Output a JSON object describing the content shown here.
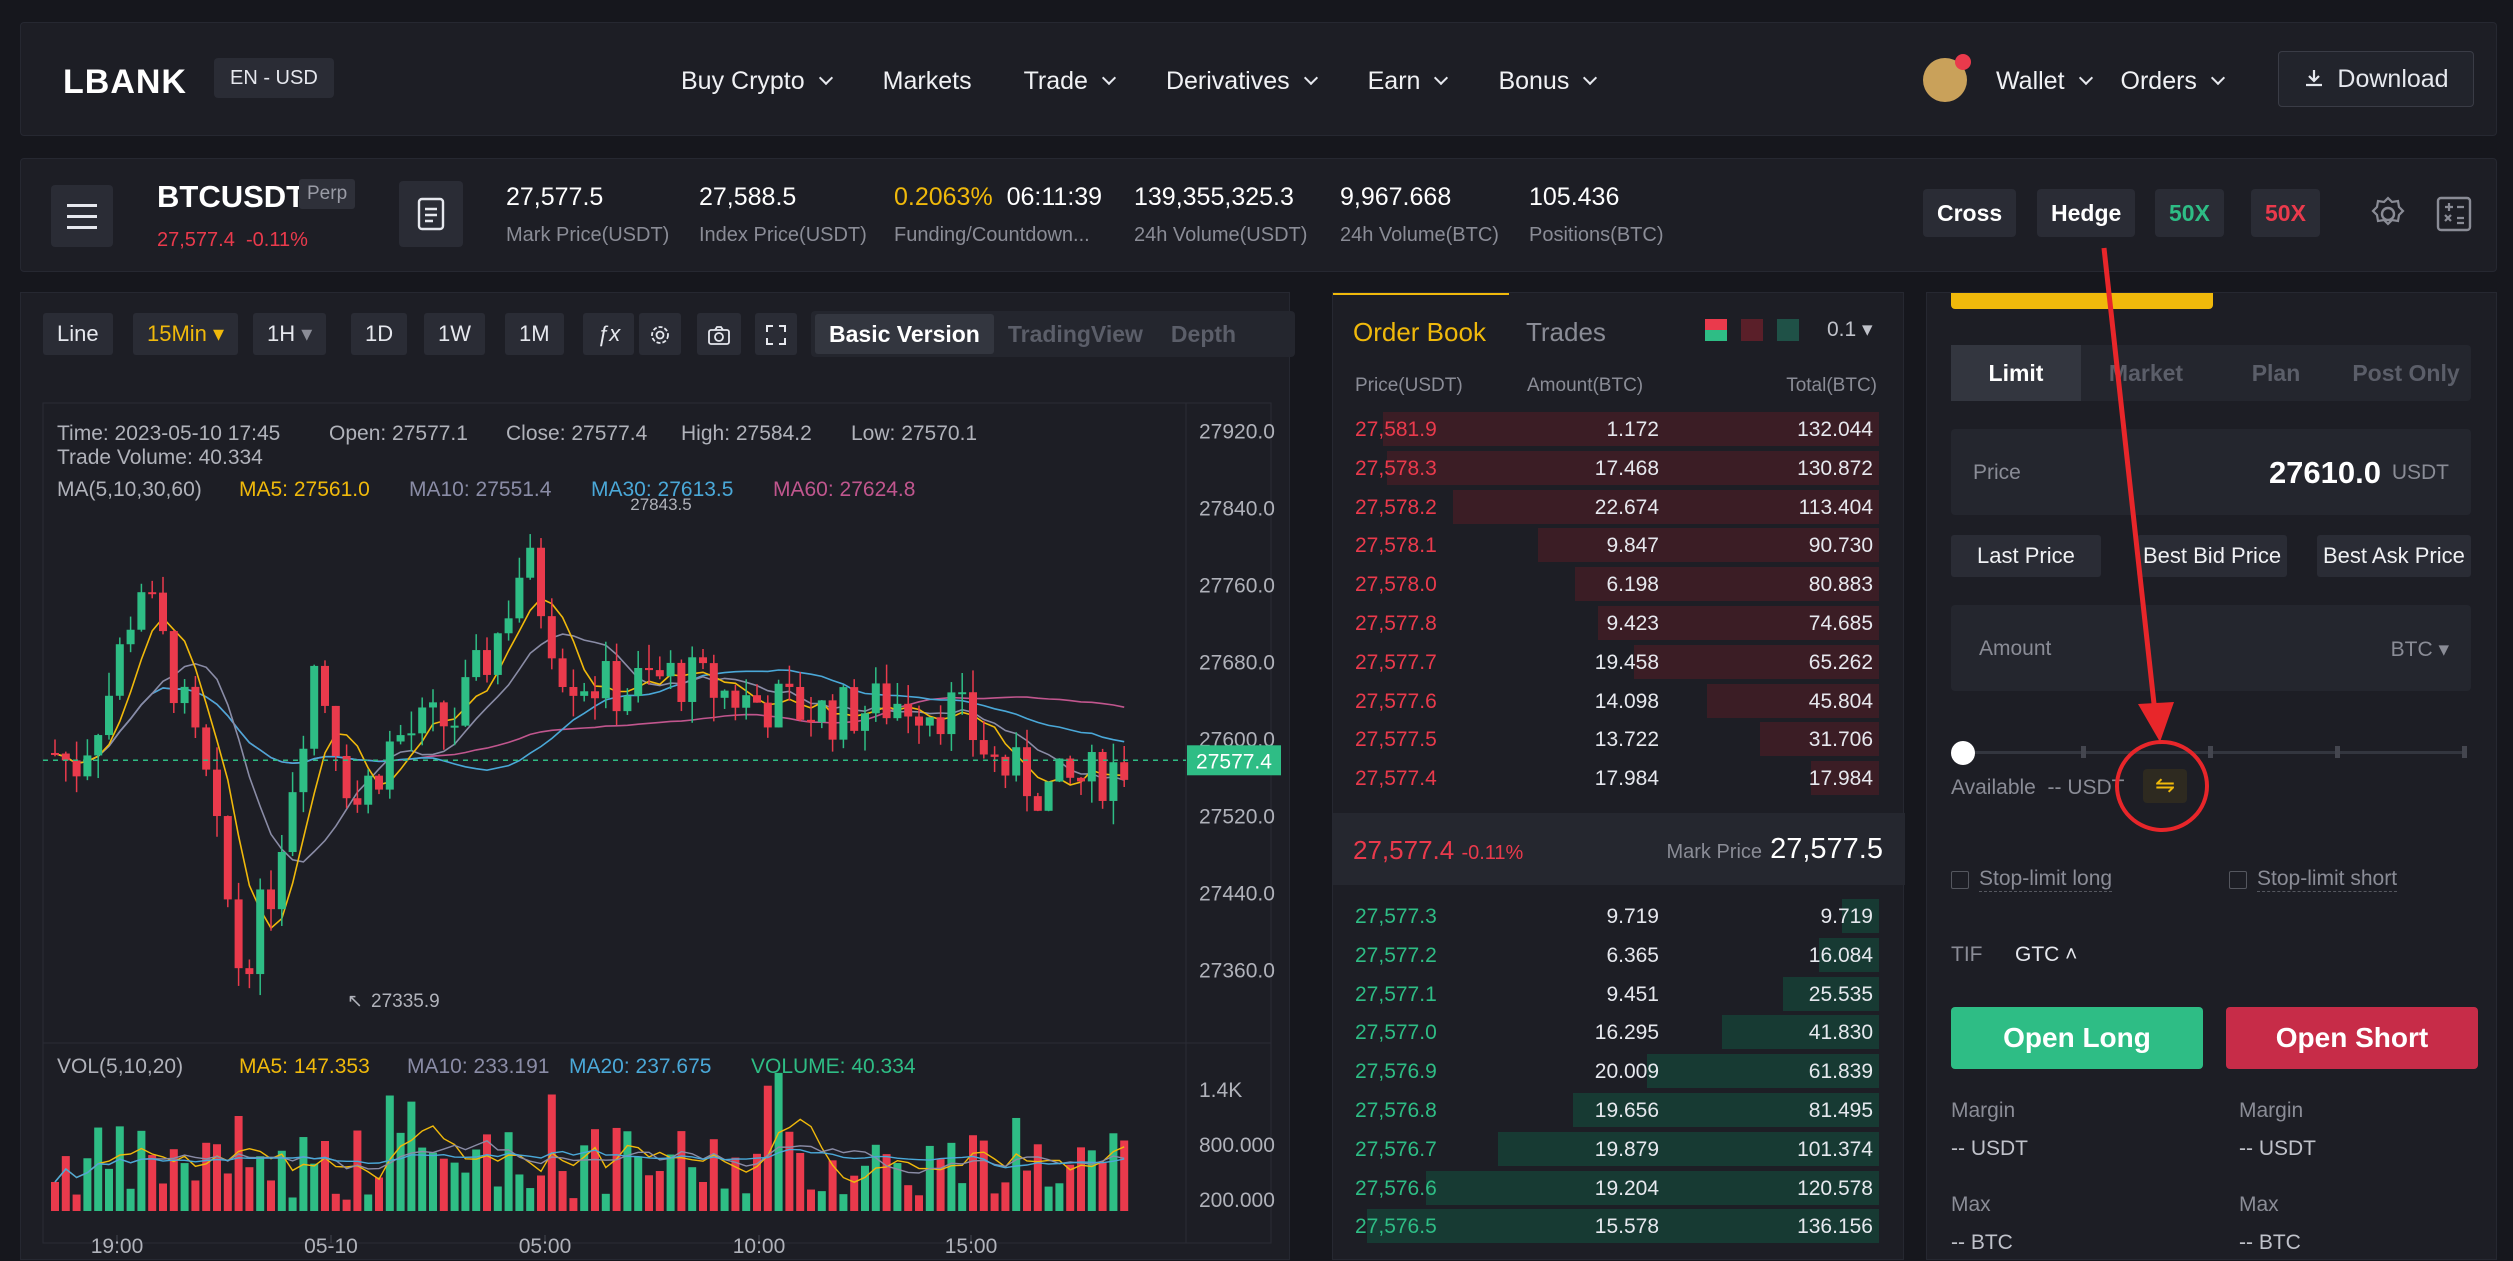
{
  "nav": {
    "logo": "LBANK",
    "lang": "EN - USD",
    "menu": [
      "Buy Crypto",
      "Markets",
      "Trade",
      "Derivatives",
      "Earn",
      "Bonus"
    ],
    "menu_chevron": [
      true,
      false,
      true,
      true,
      true,
      true
    ],
    "wallet": "Wallet",
    "orders": "Orders",
    "download": "Download"
  },
  "ticker": {
    "symbol": "BTCUSDT",
    "badge": "Perp",
    "last_price": "27,577.4",
    "change": "-0.11%",
    "stats": [
      {
        "value": "27,577.5",
        "label": "Mark Price(USDT)"
      },
      {
        "value": "27,588.5",
        "label": "Index Price(USDT)"
      },
      {
        "value": "0.2063%",
        "value2": "06:11:39",
        "label": "Funding/Countdown..."
      },
      {
        "value": "139,355,325.3",
        "label": "24h Volume(USDT)"
      },
      {
        "value": "9,967.668",
        "label": "24h Volume(BTC)"
      },
      {
        "value": "105.436",
        "label": "Positions(BTC)"
      }
    ],
    "cross": "Cross",
    "hedge": "Hedge",
    "lev_long": "50X",
    "lev_short": "50X"
  },
  "chart_toolbar": {
    "line": "Line",
    "interval": "15Min",
    "hour": "1H",
    "day": "1D",
    "week": "1W",
    "month": "1M",
    "fx": "ƒx",
    "versions": [
      "Basic Version",
      "TradingView",
      "Depth"
    ]
  },
  "chart_info": {
    "time": "Time: 2023-05-10 17:45",
    "open": "Open: 27577.1",
    "close": "Close: 27577.4",
    "high": "High: 27584.2",
    "low": "Low: 27570.1",
    "volume": "Trade Volume: 40.334",
    "ma_label": "MA(5,10,30,60)",
    "ma5": "MA5: 27561.0",
    "ma10": "MA10: 27551.4",
    "ma30": "MA30: 27613.5",
    "ma60": "MA60: 27624.8",
    "vol_label": "VOL(5,10,20)",
    "vma5": "MA5: 147.353",
    "vma10": "MA10: 233.191",
    "vma20": "MA20: 237.675",
    "vvol": "VOLUME: 40.334"
  },
  "chart_data": {
    "type": "candlestick",
    "y_ticks": [
      "27920.0",
      "27840.0",
      "27760.0",
      "27680.0",
      "27600.0",
      "27520.0",
      "27440.0",
      "27360.0"
    ],
    "ylim": [
      27286,
      27940
    ],
    "vol_ticks": [
      "1.4K",
      "800.000",
      "200.000"
    ],
    "x_ticks": [
      "19:00",
      "05-10",
      "05:00",
      "10:00",
      "15:00"
    ],
    "current_price": "27577.4",
    "high_marker": "27843.5",
    "low_marker": "27335.9",
    "colors": {
      "up": "#2ebd85",
      "down": "#ea3a4c",
      "ma5": "#f0b90b",
      "ma10": "#8a8ca6",
      "ma30": "#4aa8d8",
      "ma60": "#c1568e"
    }
  },
  "orderbook": {
    "tab_active": "Order Book",
    "tab_other": "Trades",
    "precision": "0.1",
    "headers": [
      "Price(USDT)",
      "Amount(BTC)",
      "Total(BTC)"
    ],
    "asks": [
      {
        "p": "27,581.9",
        "a": "1.172",
        "t": "132.044"
      },
      {
        "p": "27,578.3",
        "a": "17.468",
        "t": "130.872"
      },
      {
        "p": "27,578.2",
        "a": "22.674",
        "t": "113.404"
      },
      {
        "p": "27,578.1",
        "a": "9.847",
        "t": "90.730"
      },
      {
        "p": "27,578.0",
        "a": "6.198",
        "t": "80.883"
      },
      {
        "p": "27,577.8",
        "a": "9.423",
        "t": "74.685"
      },
      {
        "p": "27,577.7",
        "a": "19.458",
        "t": "65.262"
      },
      {
        "p": "27,577.6",
        "a": "14.098",
        "t": "45.804"
      },
      {
        "p": "27,577.5",
        "a": "13.722",
        "t": "31.706"
      },
      {
        "p": "27,577.4",
        "a": "17.984",
        "t": "17.984"
      }
    ],
    "mid_price": "27,577.4",
    "mid_change": "-0.11%",
    "mark_label": "Mark Price",
    "mark_price": "27,577.5",
    "bids": [
      {
        "p": "27,577.3",
        "a": "9.719",
        "t": "9.719"
      },
      {
        "p": "27,577.2",
        "a": "6.365",
        "t": "16.084"
      },
      {
        "p": "27,577.1",
        "a": "9.451",
        "t": "25.535"
      },
      {
        "p": "27,577.0",
        "a": "16.295",
        "t": "41.830"
      },
      {
        "p": "27,576.9",
        "a": "20.009",
        "t": "61.839"
      },
      {
        "p": "27,576.8",
        "a": "19.656",
        "t": "81.495"
      },
      {
        "p": "27,576.7",
        "a": "19.879",
        "t": "101.374"
      },
      {
        "p": "27,576.6",
        "a": "19.204",
        "t": "120.578"
      },
      {
        "p": "27,576.5",
        "a": "15.578",
        "t": "136.156"
      }
    ]
  },
  "trade": {
    "tabs": [
      "Limit",
      "Market",
      "Plan",
      "Post Only"
    ],
    "price_label": "Price",
    "price_value": "27610.0",
    "price_unit": "USDT",
    "quick": [
      "Last Price",
      "Best Bid Price",
      "Best Ask Price"
    ],
    "amount_placeholder": "Amount",
    "amount_unit": "BTC",
    "available_label": "Available",
    "available_value": "-- USDT",
    "stop_long": "Stop-limit long",
    "stop_short": "Stop-limit short",
    "tif_label": "TIF",
    "tif_value": "GTC",
    "open_long": "Open Long",
    "open_short": "Open Short",
    "margin_label": "Margin",
    "margin_value": "-- USDT",
    "max_label": "Max",
    "max_value": "-- BTC",
    "colors": {
      "long": "#2ebd85",
      "short": "#c72c48"
    }
  }
}
